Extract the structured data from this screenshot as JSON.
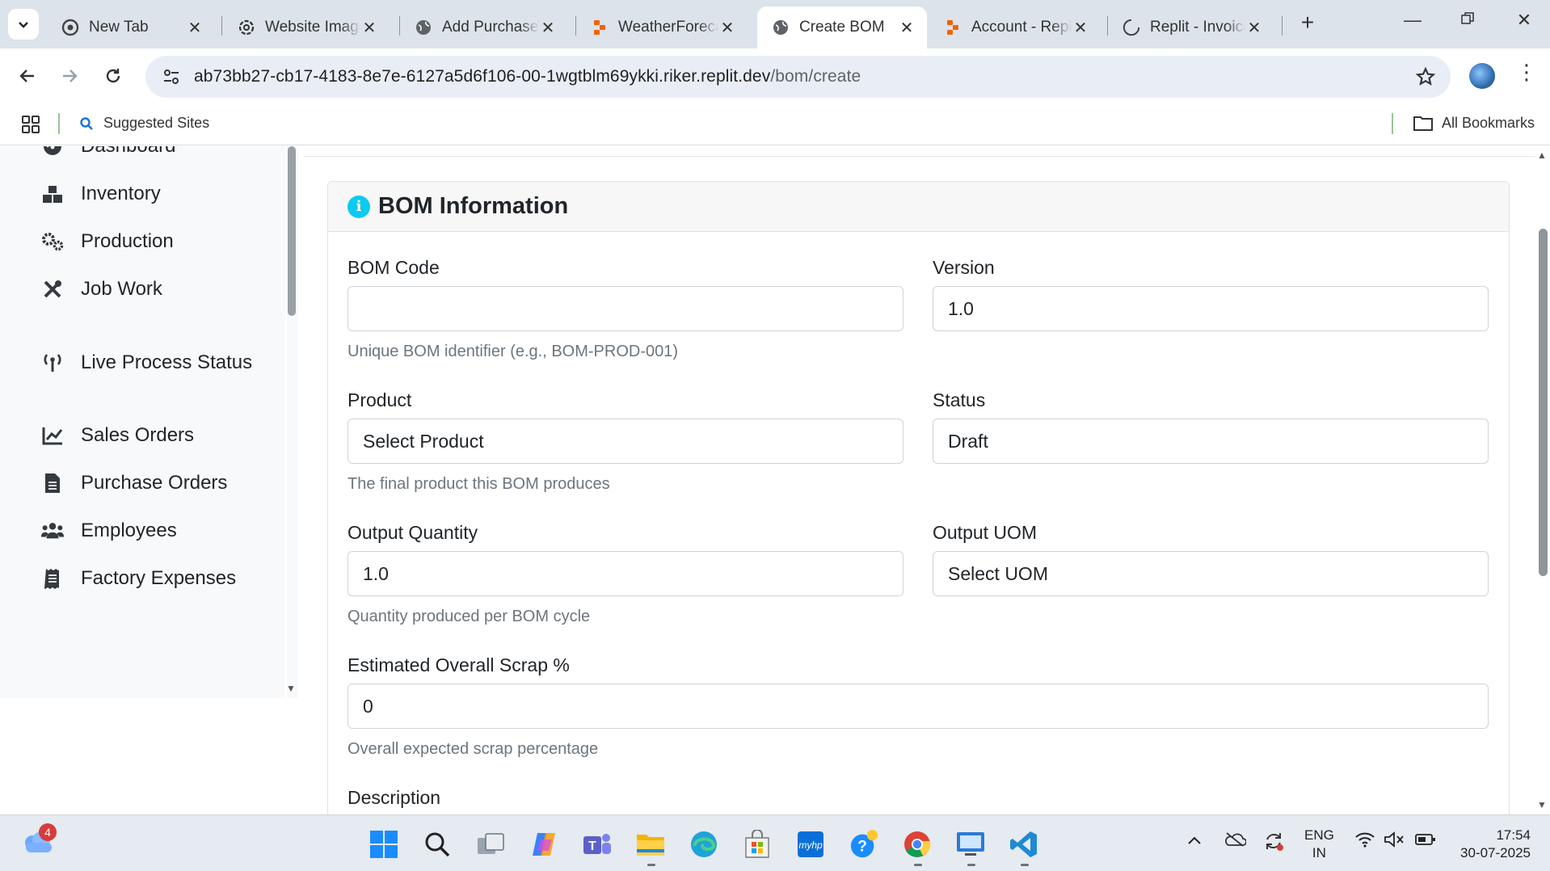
{
  "browser": {
    "tabs": [
      {
        "title": "New Tab",
        "icon": "chrome-icon"
      },
      {
        "title": "Website Image Manager",
        "icon": "openai-icon"
      },
      {
        "title": "Add Purchase Order",
        "icon": "globe-icon"
      },
      {
        "title": "WeatherForecast",
        "icon": "replit-icon"
      },
      {
        "title": "Create BOM",
        "icon": "globe-icon",
        "active": true
      },
      {
        "title": "Account - Replit",
        "icon": "replit-icon"
      },
      {
        "title": "Replit - Invoice",
        "icon": "loading-icon"
      }
    ],
    "url_host": "ab73bb27-cb17-4183-8e7e-6127a5d6f106-00-1wgtblm69ykki.riker.replit.dev",
    "url_path": "/bom/create",
    "bookmarks": {
      "suggested": "Suggested Sites",
      "all": "All Bookmarks"
    }
  },
  "sidebar": {
    "items": [
      {
        "label": "Dashboard",
        "icon": "dashboard-icon"
      },
      {
        "label": "Inventory",
        "icon": "boxes-icon"
      },
      {
        "label": "Production",
        "icon": "cogs-icon"
      },
      {
        "label": "Job Work",
        "icon": "tools-icon"
      },
      {
        "label": "Live Process Status",
        "icon": "broadcast-icon"
      },
      {
        "label": "Sales Orders",
        "icon": "chart-line-icon"
      },
      {
        "label": "Purchase Orders",
        "icon": "file-invoice-icon"
      },
      {
        "label": "Employees",
        "icon": "users-icon"
      },
      {
        "label": "Factory Expenses",
        "icon": "receipt-icon"
      }
    ]
  },
  "card": {
    "title": "BOM Information",
    "bom_code": {
      "label": "BOM Code",
      "value": "",
      "help": "Unique BOM identifier (e.g., BOM-PROD-001)"
    },
    "version": {
      "label": "Version",
      "value": "1.0"
    },
    "product": {
      "label": "Product",
      "value": "Select Product",
      "help": "The final product this BOM produces"
    },
    "status": {
      "label": "Status",
      "value": "Draft"
    },
    "output_quantity": {
      "label": "Output Quantity",
      "value": "1.0",
      "help": "Quantity produced per BOM cycle"
    },
    "output_uom": {
      "label": "Output UOM",
      "value": "Select UOM"
    },
    "scrap": {
      "label": "Estimated Overall Scrap %",
      "value": "0",
      "help": "Overall expected scrap percentage"
    },
    "description": {
      "label": "Description"
    }
  },
  "taskbar": {
    "weather_badge": "4",
    "lang_top": "ENG",
    "lang_bottom": "IN",
    "time": "17:54",
    "date": "30-07-2025"
  },
  "colors": {
    "accent_info": "#0dcaf0",
    "chrome_tabbar": "#dde3ea",
    "omnibox": "#e9eef6"
  }
}
